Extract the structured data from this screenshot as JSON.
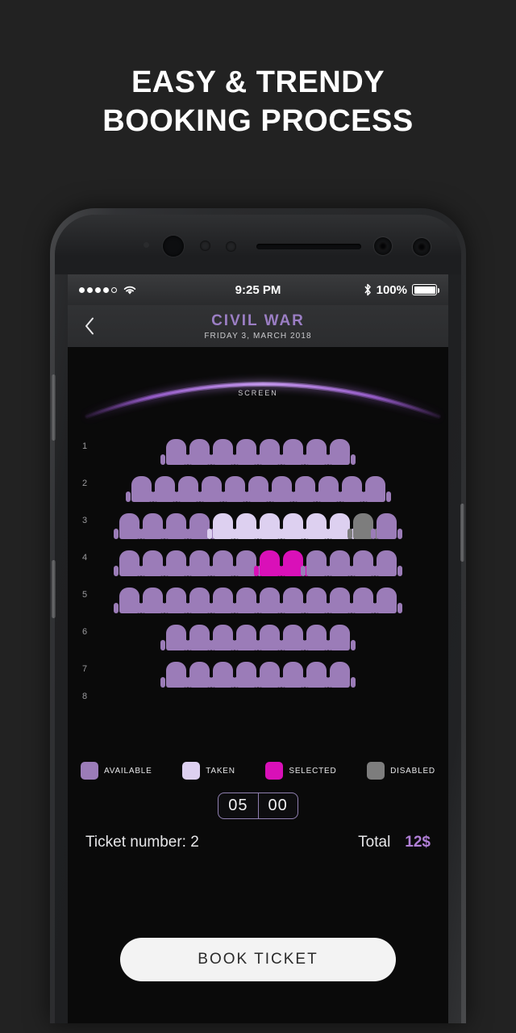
{
  "promo": {
    "line1": "EASY & TRENDY",
    "line2": "BOOKING PROCESS"
  },
  "statusbar": {
    "signal_filled": 4,
    "signal_empty": 1,
    "wifi_icon": "wifi-icon",
    "time": "9:25 PM",
    "bluetooth_icon": "bluetooth-icon",
    "battery_percent": "100%",
    "battery_icon": "battery-full-icon"
  },
  "navbar": {
    "back_icon": "chevron-left-icon",
    "title": "CIVIL WAR",
    "date": "FRIDAY 3, MARCH 2018"
  },
  "hall": {
    "screen_label": "SCREEN",
    "row_labels": [
      "1",
      "2",
      "3",
      "4",
      "5",
      "6",
      "7",
      "8"
    ],
    "rows": [
      {
        "label": "1",
        "seats": [
          "available",
          "available",
          "available",
          "available",
          "available",
          "available",
          "available",
          "available"
        ]
      },
      {
        "label": "2",
        "seats": [
          "available",
          "available",
          "available",
          "available",
          "available",
          "available",
          "available",
          "available",
          "available",
          "available",
          "available"
        ]
      },
      {
        "label": "3",
        "seats": [
          "available",
          "available",
          "available",
          "available",
          "taken",
          "taken",
          "taken",
          "taken",
          "taken",
          "taken",
          "disabled",
          "available"
        ]
      },
      {
        "label": "4",
        "seats": [
          "available",
          "available",
          "available",
          "available",
          "available",
          "available",
          "selected",
          "selected",
          "available",
          "available",
          "available",
          "available"
        ]
      },
      {
        "label": "5",
        "seats": [
          "available",
          "available",
          "available",
          "available",
          "available",
          "available",
          "available",
          "available",
          "available",
          "available",
          "available",
          "available"
        ]
      },
      {
        "label": "6",
        "seats": [
          "available",
          "available",
          "available",
          "available",
          "available",
          "available",
          "available",
          "available"
        ]
      },
      {
        "label": "7",
        "seats": [
          "available",
          "available",
          "available",
          "available",
          "available",
          "available",
          "available",
          "available"
        ]
      }
    ]
  },
  "legend": [
    {
      "key": "available",
      "label": "AVAILABLE",
      "color": "#9b7cb8"
    },
    {
      "key": "taken",
      "label": "TAKEN",
      "color": "#ddd0f0"
    },
    {
      "key": "selected",
      "label": "SELECTED",
      "color": "#d910b8"
    },
    {
      "key": "disabled",
      "label": "DISABLED",
      "color": "#7d7d7d"
    }
  ],
  "timer": {
    "minutes": "05",
    "seconds": "00"
  },
  "summary": {
    "ticket_number": "Ticket number: 2",
    "total_label": "Total",
    "total_value": "12$"
  },
  "actions": {
    "book_label": "BOOK TICKET"
  },
  "colors": {
    "accent_purple": "#9b7ec4",
    "seat_available": "#9b7cb8",
    "seat_taken": "#ddd0f0",
    "seat_selected": "#d910b8",
    "seat_disabled": "#7d7d7d",
    "total_value": "#b07fd6",
    "page_bg": "#222222",
    "screen_bg": "#0a0a0a"
  }
}
